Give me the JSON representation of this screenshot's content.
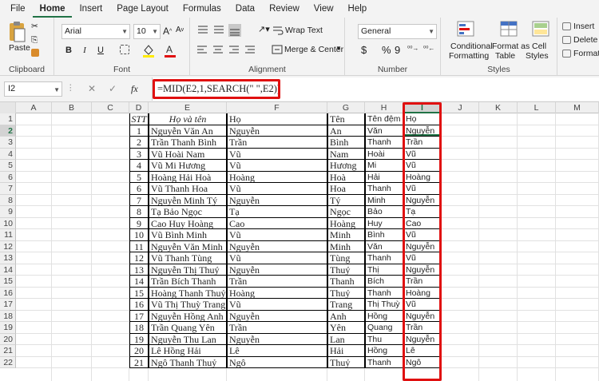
{
  "menu": [
    "File",
    "Home",
    "Insert",
    "Page Layout",
    "Formulas",
    "Data",
    "Review",
    "View",
    "Help"
  ],
  "ribbon": {
    "clipboard": {
      "paste": "Paste",
      "label": "Clipboard"
    },
    "font": {
      "name": "Arial",
      "size": "10",
      "bold": "B",
      "italic": "I",
      "underline": "U",
      "color_a": "A",
      "label": "Font"
    },
    "alignment": {
      "wrap": "Wrap Text",
      "merge": "Merge & Center",
      "label": "Alignment"
    },
    "number": {
      "format": "General",
      "currency": "$",
      "percent": "%",
      "comma": "9",
      "label": "Number"
    },
    "styles": {
      "conditional": "Conditional",
      "formatting": "Formatting",
      "format_as": "Format as",
      "table": "Table",
      "cell": "Cell",
      "styles_btn": "Styles",
      "label": "Styles"
    },
    "cells": {
      "insert": "Insert",
      "delete": "Delete",
      "format": "Format"
    }
  },
  "formula_bar": {
    "name_box": "I2",
    "cancel": "✕",
    "enter": "✓",
    "fx": "fx",
    "formula": "=MID(E2,1,SEARCH(\" \",E2))"
  },
  "columns": [
    "A",
    "B",
    "C",
    "D",
    "E",
    "F",
    "G",
    "H",
    "I",
    "J",
    "K",
    "L",
    "M"
  ],
  "selected_column": "I",
  "selected_row": "2",
  "headers": {
    "stt": "STT",
    "fullname": "Họ và tên",
    "ho": "Họ",
    "ten": "Tên",
    "tendem": "Tên đệm",
    "result": "Họ"
  },
  "rows": [
    {
      "n": "2",
      "stt": "1",
      "name": "Nguyễn Văn An",
      "ho": "Nguyễn",
      "ten": "An",
      "dem": "Văn",
      "res": "Nguyễn"
    },
    {
      "n": "3",
      "stt": "2",
      "name": "Trần Thanh Bình",
      "ho": "Trần",
      "ten": "Bình",
      "dem": "Thanh",
      "res": "Trần"
    },
    {
      "n": "4",
      "stt": "3",
      "name": "Vũ Hoài Nam",
      "ho": "Vũ",
      "ten": "Nam",
      "dem": "Hoài",
      "res": "Vũ"
    },
    {
      "n": "5",
      "stt": "4",
      "name": "Vũ Mi Hương",
      "ho": "Vũ",
      "ten": "Hương",
      "dem": "Mi",
      "res": "Vũ"
    },
    {
      "n": "6",
      "stt": "5",
      "name": "Hoàng Hải Hoà",
      "ho": "Hoàng",
      "ten": "Hoà",
      "dem": "Hải",
      "res": "Hoàng"
    },
    {
      "n": "7",
      "stt": "6",
      "name": "Vũ Thanh Hoa",
      "ho": "Vũ",
      "ten": "Hoa",
      "dem": "Thanh",
      "res": "Vũ"
    },
    {
      "n": "8",
      "stt": "7",
      "name": "Nguyễn Minh Tý",
      "ho": "Nguyễn",
      "ten": "Tý",
      "dem": "Minh",
      "res": "Nguyễn"
    },
    {
      "n": "9",
      "stt": "8",
      "name": "Tạ Bảo Ngọc",
      "ho": "Tạ",
      "ten": "Ngọc",
      "dem": "Bảo",
      "res": "Tạ"
    },
    {
      "n": "10",
      "stt": "9",
      "name": "Cao Huy Hoàng",
      "ho": "Cao",
      "ten": "Hoàng",
      "dem": "Huy",
      "res": "Cao"
    },
    {
      "n": "11",
      "stt": "10",
      "name": "Vũ Bình Minh",
      "ho": "Vũ",
      "ten": "Minh",
      "dem": "Bình",
      "res": "Vũ"
    },
    {
      "n": "12",
      "stt": "11",
      "name": "Nguyễn Văn Minh",
      "ho": "Nguyễn",
      "ten": "Minh",
      "dem": "Văn",
      "res": "Nguyễn"
    },
    {
      "n": "13",
      "stt": "12",
      "name": "Vũ Thanh Tùng",
      "ho": "Vũ",
      "ten": "Tùng",
      "dem": "Thanh",
      "res": "Vũ"
    },
    {
      "n": "14",
      "stt": "13",
      "name": "Nguyễn Thị Thuý",
      "ho": "Nguyễn",
      "ten": "Thuý",
      "dem": "Thị",
      "res": "Nguyễn"
    },
    {
      "n": "15",
      "stt": "14",
      "name": "Trần Bích Thanh",
      "ho": "Trần",
      "ten": "Thanh",
      "dem": "Bích",
      "res": "Trần"
    },
    {
      "n": "16",
      "stt": "15",
      "name": "Hoàng Thanh Thuỷ",
      "ho": "Hoàng",
      "ten": "Thuỷ",
      "dem": "Thanh",
      "res": "Hoàng"
    },
    {
      "n": "17",
      "stt": "16",
      "name": "Vũ Thị Thuỳ Trang",
      "ho": "Vũ",
      "ten": "Trang",
      "dem": "Thị Thuỳ",
      "res": "Vũ"
    },
    {
      "n": "18",
      "stt": "17",
      "name": "Nguyễn Hồng Anh",
      "ho": "Nguyễn",
      "ten": "Anh",
      "dem": "Hồng",
      "res": "Nguyễn"
    },
    {
      "n": "19",
      "stt": "18",
      "name": "Trần Quang Yên",
      "ho": "Trần",
      "ten": "Yên",
      "dem": "Quang",
      "res": "Trần"
    },
    {
      "n": "20",
      "stt": "19",
      "name": "Nguyễn Thu Lan",
      "ho": "Nguyễn",
      "ten": "Lan",
      "dem": "Thu",
      "res": "Nguyễn"
    },
    {
      "n": "21",
      "stt": "20",
      "name": "Lê Hồng Hải",
      "ho": "Lê",
      "ten": "Hải",
      "dem": "Hồng",
      "res": "Lê"
    },
    {
      "n": "22",
      "stt": "21",
      "name": "Ngô Thanh Thuỷ",
      "ho": "Ngô",
      "ten": "Thuỷ",
      "dem": "Thanh",
      "res": "Ngô"
    }
  ],
  "colors": {
    "accent": "#217346",
    "highlight": "#e01010"
  }
}
